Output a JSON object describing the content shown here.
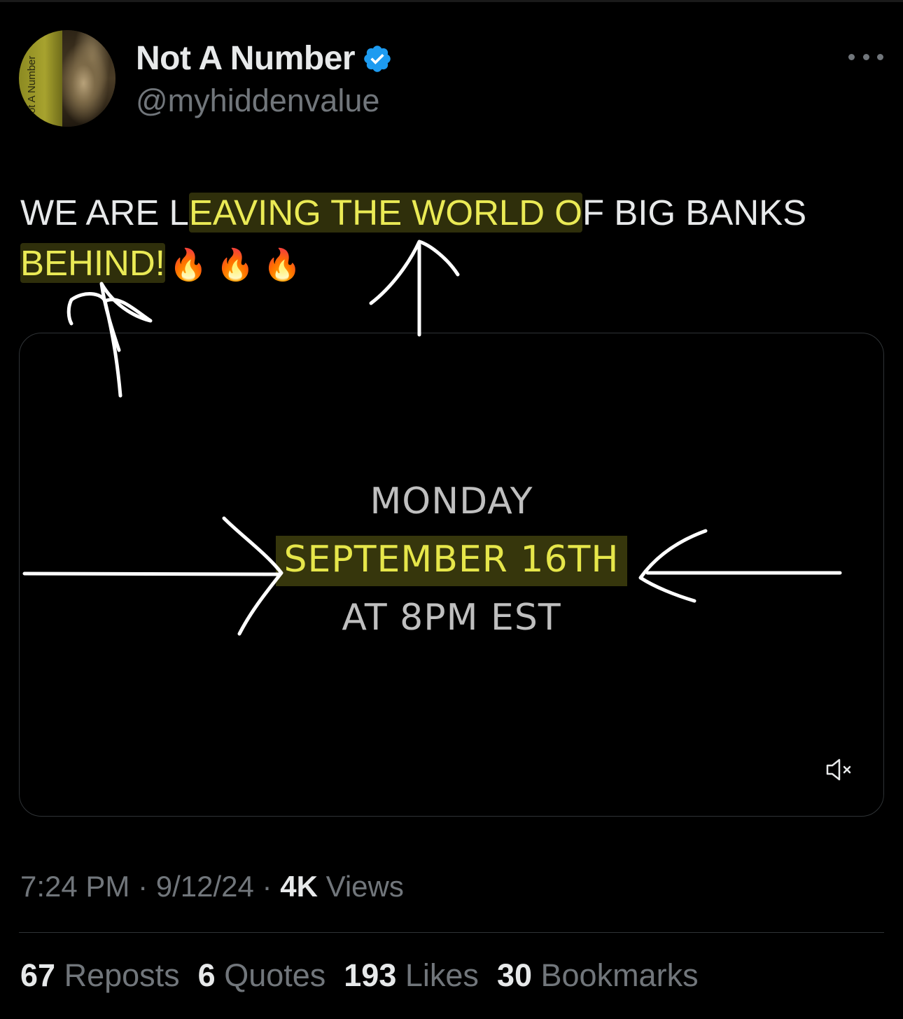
{
  "author": {
    "display_name": "Not A Number",
    "handle": "@myhiddenvalue",
    "avatar_text": "Not A Number",
    "verified": true
  },
  "tweet": {
    "text_plain_1": "WE ARE L",
    "text_hl_1": "EAVING THE WORLD O",
    "text_plain_2": "F BIG BANKS ",
    "text_hl_2": "BEHIND!",
    "emoji": "🔥 🔥 🔥"
  },
  "media": {
    "line1": "MONDAY",
    "line2": "SEPTEMBER 16TH",
    "line3": "AT 8PM EST",
    "mute_icon": "speaker-muted-icon"
  },
  "meta": {
    "time": "7:24 PM",
    "sep1": " · ",
    "date": "9/12/24",
    "sep2": " · ",
    "views_count": "4K",
    "views_label": " Views"
  },
  "stats": {
    "reposts_count": "67",
    "reposts_label": " Reposts",
    "quotes_count": "6",
    "quotes_label": " Quotes",
    "likes_count": "193",
    "likes_label": " Likes",
    "bookmarks_count": "30",
    "bookmarks_label": " Bookmarks"
  },
  "colors": {
    "background": "#000000",
    "text": "#e7e9ea",
    "muted": "#71767b",
    "highlight_text": "#eaea55",
    "verified_blue": "#1d9bf0",
    "border": "#2f3336"
  }
}
